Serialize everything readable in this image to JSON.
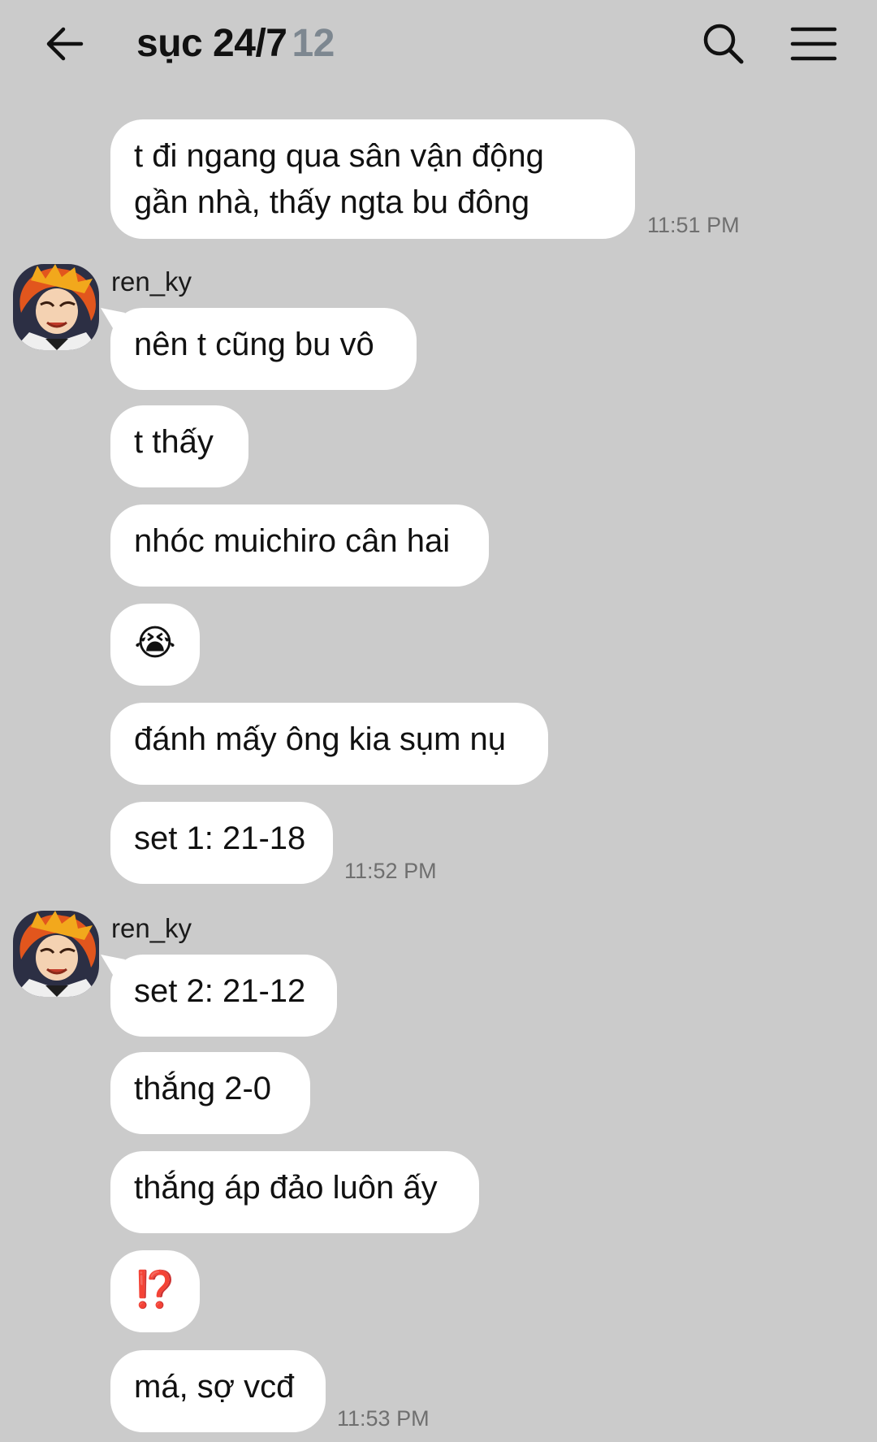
{
  "header": {
    "title": "sục 24/7",
    "member_count": "12",
    "back_icon": "arrow-left-icon",
    "search_icon": "search-icon",
    "menu_icon": "hamburger-menu-icon"
  },
  "messages": [
    {
      "text_line1": "t đi ngang qua sân vận động",
      "text_line2": "gần nhà, thấy ngta bu đông",
      "time": "11:51 PM"
    },
    {
      "sender": "ren_ky",
      "text": "nên t cũng bu vô"
    },
    {
      "text": "t thấy"
    },
    {
      "text": "nhóc muichiro cân hai"
    },
    {
      "text": "😭"
    },
    {
      "text": "đánh mấy ông kia sụm nụ"
    },
    {
      "text": "set 1: 21-18",
      "time": "11:52 PM"
    },
    {
      "sender": "ren_ky",
      "text": "set 2: 21-12"
    },
    {
      "text": "thắng 2-0"
    },
    {
      "text": "thắng áp đảo luôn ấy"
    },
    {
      "text": "⁉️"
    },
    {
      "text": "má, sợ vcđ",
      "time": "11:53 PM"
    }
  ],
  "colors": {
    "background": "#cbcbcb",
    "bubble": "#ffffff",
    "count": "#7d8790",
    "timestamp": "#6f6f6f"
  }
}
